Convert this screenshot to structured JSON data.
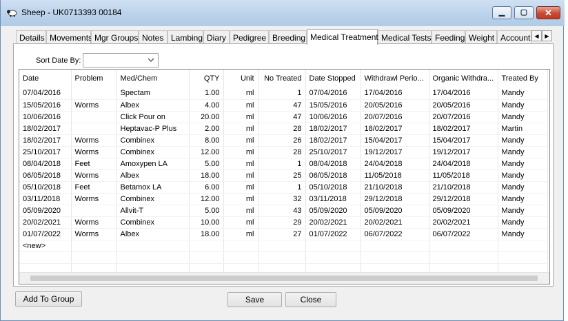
{
  "window": {
    "title": "Sheep - UK0713393 00184",
    "icon": "sheep-icon"
  },
  "controls": {
    "minimize": "▁",
    "maximize": "▢",
    "close": "✕"
  },
  "tabs": [
    {
      "label": "Details"
    },
    {
      "label": "Movements"
    },
    {
      "label": "Mgr Groups"
    },
    {
      "label": "Notes"
    },
    {
      "label": "Lambing"
    },
    {
      "label": "Diary"
    },
    {
      "label": "Pedigree"
    },
    {
      "label": "Breeding"
    },
    {
      "label": "Medical Treatment",
      "active": true
    },
    {
      "label": "Medical Tests"
    },
    {
      "label": "Feeding"
    },
    {
      "label": "Weight"
    },
    {
      "label": "Account"
    }
  ],
  "tab_scroll": {
    "left": "◀",
    "right": "▶"
  },
  "sort": {
    "label": "Sort Date By:",
    "value": ""
  },
  "grid": {
    "columns": [
      "Date",
      "Problem",
      "Med/Chem",
      "QTY",
      "Unit",
      "No Treated",
      "Date Stopped",
      "Withdrawl Perio...",
      "Organic Withdra...",
      "Treated By"
    ],
    "rows": [
      [
        "07/04/2016",
        "",
        "Spectam",
        "1.00",
        "ml",
        "1",
        "07/04/2016",
        "17/04/2016",
        "17/04/2016",
        "Mandy"
      ],
      [
        "15/05/2016",
        "Worms",
        "Albex",
        "4.00",
        "ml",
        "47",
        "15/05/2016",
        "20/05/2016",
        "20/05/2016",
        "Mandy"
      ],
      [
        "10/06/2016",
        "",
        "Click Pour on",
        "20.00",
        "ml",
        "47",
        "10/06/2016",
        "20/07/2016",
        "20/07/2016",
        "Mandy"
      ],
      [
        "18/02/2017",
        "",
        "Heptavac-P Plus",
        "2.00",
        "ml",
        "28",
        "18/02/2017",
        "18/02/2017",
        "18/02/2017",
        "Martin"
      ],
      [
        "18/02/2017",
        "Worms",
        "Combinex",
        "8.00",
        "ml",
        "26",
        "18/02/2017",
        "15/04/2017",
        "15/04/2017",
        "Mandy"
      ],
      [
        "25/10/2017",
        "Worms",
        "Combinex",
        "12.00",
        "ml",
        "28",
        "25/10/2017",
        "19/12/2017",
        "19/12/2017",
        "Mandy"
      ],
      [
        "08/04/2018",
        "Feet",
        "Amoxypen LA",
        "5.00",
        "ml",
        "1",
        "08/04/2018",
        "24/04/2018",
        "24/04/2018",
        "Mandy"
      ],
      [
        "06/05/2018",
        "Worms",
        "Albex",
        "18.00",
        "ml",
        "25",
        "06/05/2018",
        "11/05/2018",
        "11/05/2018",
        "Mandy"
      ],
      [
        "05/10/2018",
        "Feet",
        "Betamox LA",
        "6.00",
        "ml",
        "1",
        "05/10/2018",
        "21/10/2018",
        "21/10/2018",
        "Mandy"
      ],
      [
        "03/11/2018",
        "Worms",
        "Combinex",
        "12.00",
        "ml",
        "32",
        "03/11/2018",
        "29/12/2018",
        "29/12/2018",
        "Mandy"
      ],
      [
        "05/09/2020",
        "",
        "Allvit-T",
        "5.00",
        "ml",
        "43",
        "05/09/2020",
        "05/09/2020",
        "05/09/2020",
        "Mandy"
      ],
      [
        "20/02/2021",
        "Worms",
        "Combinex",
        "10.00",
        "ml",
        "29",
        "20/02/2021",
        "20/02/2021",
        "20/02/2021",
        "Mandy"
      ],
      [
        "01/07/2022",
        "Worms",
        "Albex",
        "18.00",
        "ml",
        "27",
        "01/07/2022",
        "06/07/2022",
        "06/07/2022",
        "Mandy"
      ]
    ],
    "new_row_label": "<new>"
  },
  "buttons": {
    "add_to_group": "Add To Group",
    "save": "Save",
    "close": "Close"
  }
}
